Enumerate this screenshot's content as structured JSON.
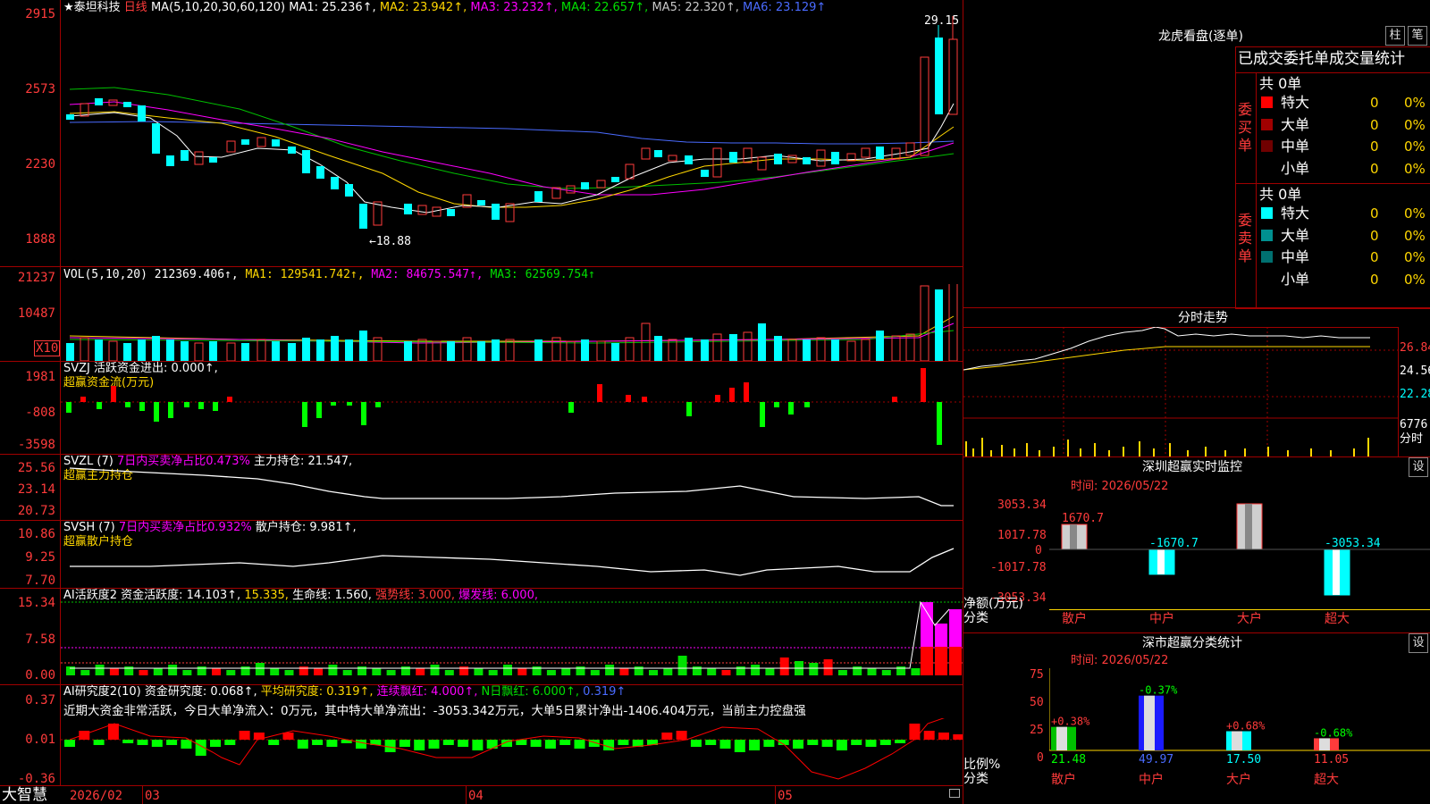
{
  "stock": {
    "name": "★泰坦科技",
    "period": "日线"
  },
  "price_axis": [
    "2915",
    "2573",
    "2230",
    "1888"
  ],
  "ma_legend": {
    "params": "MA(5,10,20,30,60,120)",
    "ma1": "MA1: 25.236↑,",
    "ma2": "MA2: 23.942↑,",
    "ma3": "MA3: 23.232↑,",
    "ma4": "MA4: 22.657↑,",
    "ma5": "MA5: 22.320↑,",
    "ma6": "MA6: 23.129↑"
  },
  "price_annotations": {
    "high": "29.15",
    "low": "←18.88"
  },
  "vol": {
    "axis": [
      "21237",
      "10487",
      "X10"
    ],
    "params": "VOL(5,10,20)",
    "v": "212369.406↑,",
    "ma1": "MA1: 129541.742↑,",
    "ma2": "MA2: 84675.547↑,",
    "ma3": "MA3: 62569.754↑"
  },
  "svzj": {
    "axis": [
      "1981",
      "-808",
      "-3598"
    ],
    "line1": "SVZJ  活跃资金进出: 0.000↑,",
    "line2": "超赢资金流(万元)"
  },
  "svzl": {
    "axis": [
      "25.56",
      "23.14",
      "20.73"
    ],
    "params": "SVZL (7)",
    "ratio": "7日内买卖净占比0.473%",
    "hold": "主力持仓: 21.547,",
    "line2": "超赢主力持仓"
  },
  "svsh": {
    "axis": [
      "10.86",
      "9.25",
      "7.70"
    ],
    "params": "SVSH (7)",
    "ratio": "7日内买卖净占比0.932%",
    "hold": "散户持仓: 9.981↑,",
    "line2": "超赢散户持仓"
  },
  "ai_active": {
    "axis": [
      "15.34",
      "7.58",
      "0.00"
    ],
    "name": "AI活跃度2",
    "a": "资金活跃度: 14.103↑,",
    "b": "15.335,",
    "c": "生命线: 1.560,",
    "d": "强势线: 3.000,",
    "e": "爆发线: 6.000,"
  },
  "ai_research": {
    "axis": [
      "0.37",
      "0.01",
      "-0.36"
    ],
    "name": "AI研究度2(10)",
    "a": "资金研究度: 0.068↑,",
    "b": "平均研究度: 0.319↑,",
    "c": "连续飘红: 4.000↑,",
    "d": "N日飘红: 6.000↑,",
    "e": "0.319↑",
    "summary": "近期大资金非常活跃，今日大单净流入：0万元，其中特大单净流出：-3053.342万元，大单5日累计净出-1406.404万元，当前主力控盘强"
  },
  "bottom_bar": {
    "brand": "大智慧",
    "dates": [
      "2026/02",
      "03",
      "04",
      "05"
    ]
  },
  "dragon": {
    "title": "龙虎看盘(逐单)",
    "btn1": "柱",
    "btn2": "笔",
    "header": "已成交委托单成交量统计",
    "buy_label": "委买单",
    "sell_label": "委卖单",
    "buy_total": "共 0单",
    "sell_total": "共 0单",
    "buy_rows": [
      {
        "name": "特大",
        "count": "0",
        "pct": "0%",
        "color": "#ff0000"
      },
      {
        "name": "大单",
        "count": "0",
        "pct": "0%",
        "color": "#a00000"
      },
      {
        "name": "中单",
        "count": "0",
        "pct": "0%",
        "color": "#700000"
      },
      {
        "name": "小单",
        "count": "0",
        "pct": "0%",
        "color": "#000000"
      }
    ],
    "sell_rows": [
      {
        "name": "特大",
        "count": "0",
        "pct": "0%",
        "color": "#00ffff"
      },
      {
        "name": "大单",
        "count": "0",
        "pct": "0%",
        "color": "#009090"
      },
      {
        "name": "中单",
        "count": "0",
        "pct": "0%",
        "color": "#007070"
      },
      {
        "name": "小单",
        "count": "0",
        "pct": "0%",
        "color": "#000000"
      }
    ]
  },
  "intraday": {
    "title": "分时走势",
    "axis": [
      "26.84",
      "24.56",
      "22.28",
      "6776",
      "分时"
    ]
  },
  "sz_monitor": {
    "title": "深圳超赢实时监控",
    "btn": "设",
    "time": "时间: 2026/05/22",
    "axis": [
      "3053.34",
      "1017.78",
      "0",
      "-1017.78",
      "-3053.34"
    ],
    "ylabel1": "净额(万元)",
    "ylabel2": "分类",
    "categories": [
      "散户",
      "中户",
      "大户",
      "超大"
    ],
    "values": [
      1670.7,
      -1670.7,
      3053.34,
      -3053.34
    ],
    "value_labels": [
      "1670.7",
      "-1670.7",
      "3053.34",
      "-3053.34"
    ]
  },
  "sz_class": {
    "title": "深市超赢分类统计",
    "btn": "设",
    "time": "时间: 2026/05/22",
    "axis": [
      "75",
      "50",
      "25",
      "0"
    ],
    "ylabel1": "比例%",
    "ylabel2": "分类",
    "categories": [
      "散户",
      "中户",
      "大户",
      "超大"
    ],
    "values": [
      21.48,
      49.97,
      17.5,
      11.05
    ],
    "value_labels": [
      "21.48",
      "49.97",
      "17.50",
      "11.05"
    ],
    "changes": [
      "+0.38%",
      "-0.37%",
      "+0.68%",
      "-0.68%"
    ]
  }
}
